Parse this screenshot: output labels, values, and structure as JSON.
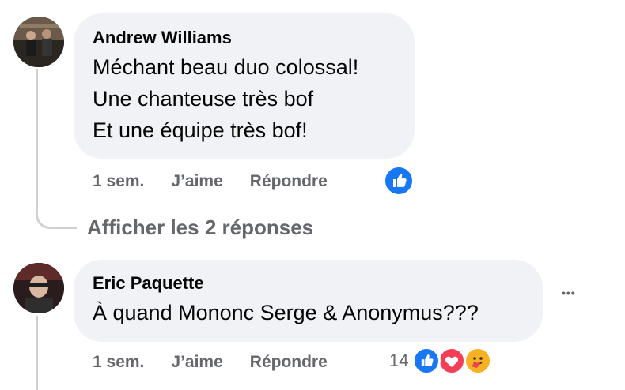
{
  "comments": [
    {
      "author": "Andrew Williams",
      "lines": [
        "Méchant beau duo colossal!",
        "Une chanteuse très bof",
        "Et une équipe très bof!"
      ],
      "time": "1 sem.",
      "like_label": "J’aime",
      "reply_label": "Répondre",
      "reactions": [
        "like-icon"
      ]
    },
    {
      "author": "Eric Paquette",
      "lines": [
        "À quand Mononc Serge & Anonymus???"
      ],
      "time": "1 sem.",
      "like_label": "J’aime",
      "reply_label": "Répondre",
      "reaction_count": "14",
      "reactions": [
        "like-icon",
        "love-icon",
        "care-icon"
      ]
    }
  ],
  "replies_link": "Afficher les 2 réponses",
  "more_label": "•••",
  "colors": {
    "like": "#1877f2",
    "love": "#f33e58",
    "care": "#f7b125",
    "muted": "#65676b",
    "bubble": "#f0f2f5"
  }
}
